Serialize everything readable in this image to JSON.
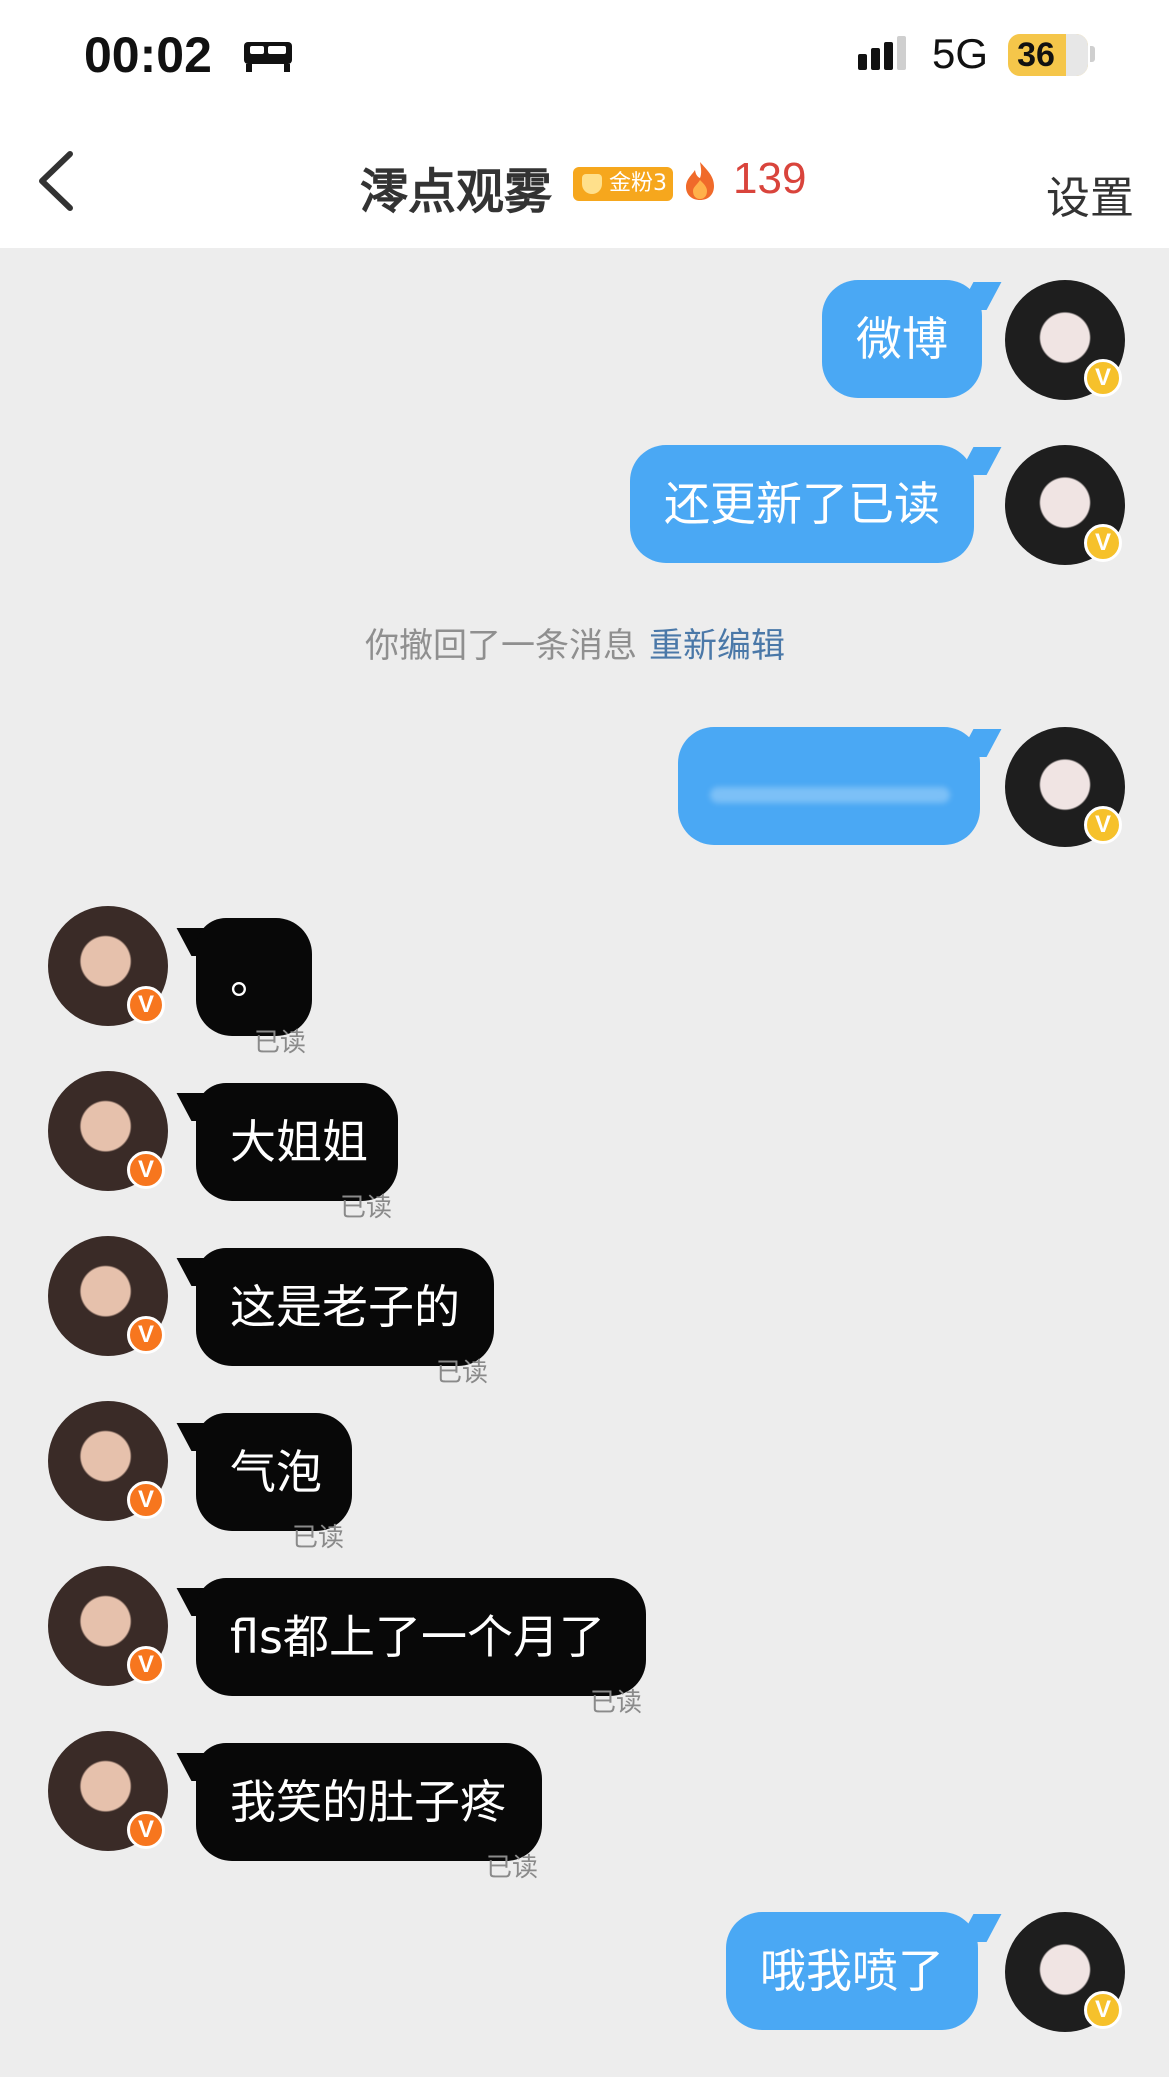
{
  "status_bar": {
    "time": "00:02",
    "network": "5G",
    "battery": "36",
    "icons": [
      "bed-icon",
      "cellular-signal-icon",
      "battery-icon"
    ]
  },
  "header": {
    "back_icon": "chevron-left-icon",
    "title": "澪点观雾",
    "fan_badge": "金粉3",
    "fan_badge_icon": "shield-icon",
    "fire_icon": "flame-icon",
    "fire_count": "139",
    "settings": "设置"
  },
  "system_notice": {
    "text": "你撤回了一条消息",
    "action": "重新编辑"
  },
  "messages": [
    {
      "side": "right",
      "text": "微博"
    },
    {
      "side": "right",
      "text": "还更新了已读"
    },
    {
      "side": "right",
      "text": ""
    },
    {
      "side": "left",
      "text": "。",
      "status": "已读"
    },
    {
      "side": "left",
      "text": "大姐姐",
      "status": "已读"
    },
    {
      "side": "left",
      "text": "这是老子的",
      "status": "已读"
    },
    {
      "side": "left",
      "text": "气泡",
      "status": "已读"
    },
    {
      "side": "left",
      "text": "fls都上了一个月了",
      "status": "已读"
    },
    {
      "side": "left",
      "text": "我笑的肚子疼",
      "status": "已读"
    },
    {
      "side": "right",
      "text": "哦我喷了"
    }
  ],
  "colors": {
    "sent_bubble": "#4aa8f4",
    "received_bubble": "#080808",
    "verified_badge_gold": "#f6c12b",
    "verified_badge_orange": "#f7761e",
    "fire_count": "#d9443c",
    "link": "#4a78a8"
  },
  "verified_mark": "V"
}
